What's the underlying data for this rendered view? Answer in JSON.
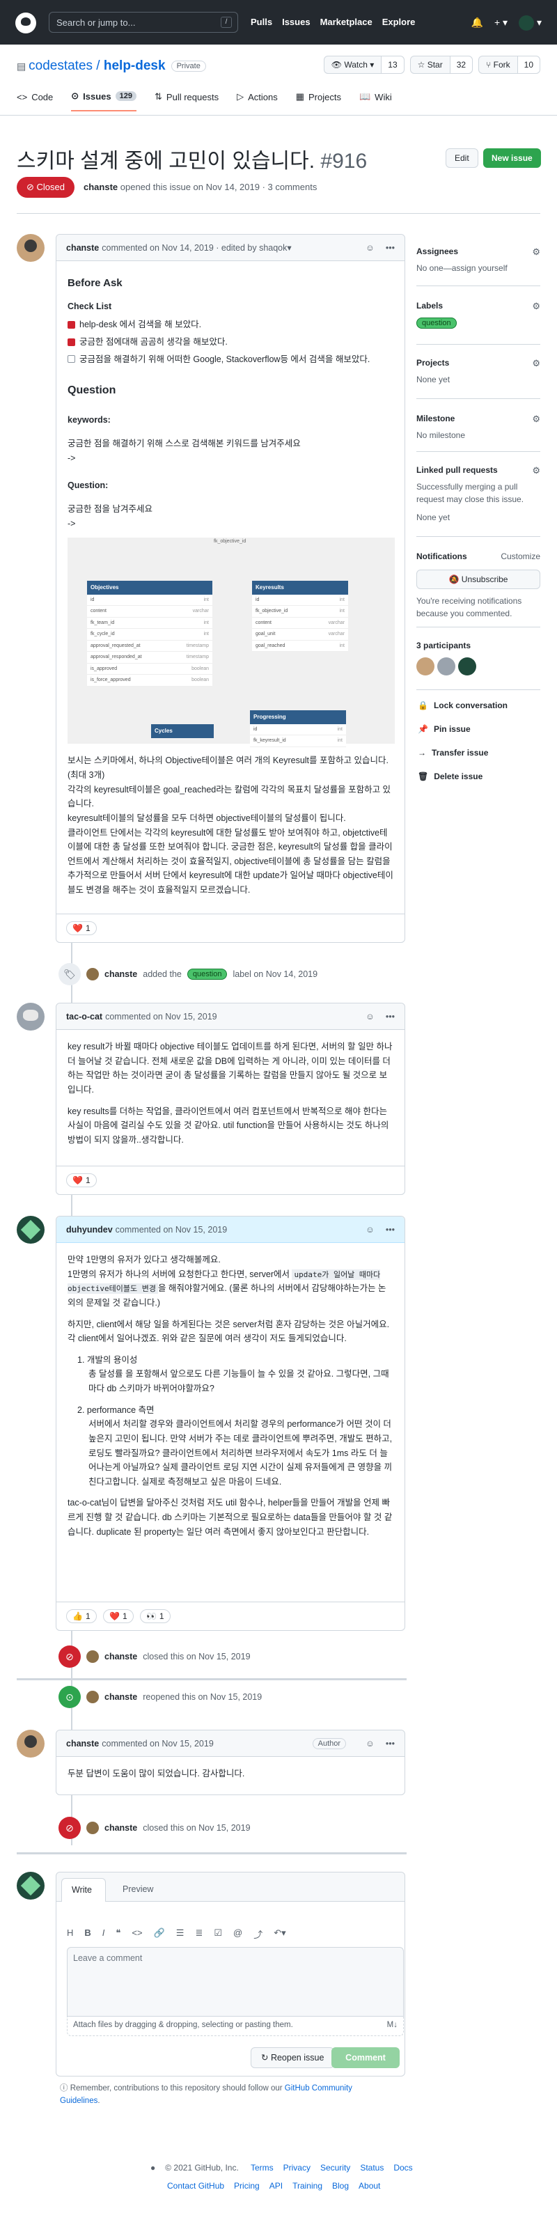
{
  "header": {
    "search_placeholder": "Search or jump to...",
    "slash": "/",
    "nav": [
      "Pulls",
      "Issues",
      "Marketplace",
      "Explore"
    ]
  },
  "repo": {
    "owner": "codestates",
    "sep": " / ",
    "name": "help-desk",
    "visibility": "Private",
    "watch": {
      "label": "Watch",
      "count": "13"
    },
    "star": {
      "label": "Star",
      "count": "32"
    },
    "fork": {
      "label": "Fork",
      "count": "10"
    }
  },
  "tabs": [
    {
      "label": "Code"
    },
    {
      "label": "Issues",
      "count": "129"
    },
    {
      "label": "Pull requests"
    },
    {
      "label": "Actions"
    },
    {
      "label": "Projects"
    },
    {
      "label": "Wiki"
    }
  ],
  "issue": {
    "title": "스키마 설계 중에 고민이 있습니다.",
    "number": "#916",
    "edit": "Edit",
    "new_issue": "New issue",
    "state": "Closed",
    "author": "chanste",
    "meta": "opened this issue on Nov 14, 2019 · 3 comments"
  },
  "c1": {
    "author": "chanste",
    "meta": "commented on Nov 14, 2019 · edited by shaqok",
    "before_ask": "Before Ask",
    "checklist": "Check List",
    "items": [
      "help-desk 에서 검색을 해 보았다.",
      "궁금한 점에대해 곰곰히 생각을 해보았다.",
      "궁금점을 해결하기 위해 어떠한 Google, Stackoverflow등 에서 검색을 해보았다."
    ],
    "question": "Question",
    "keywords": "keywords:",
    "kw_text": "궁금한 점을 해결하기 위해 스스로 검색해본 키워드를 남겨주세요",
    "arrow": "->",
    "question2": "Question:",
    "q_text": "궁금한 점을 남겨주세요",
    "diagram": {
      "top_label": "fk_objective_id",
      "objectives": {
        "title": "Objectives",
        "rows": [
          [
            "id",
            "int"
          ],
          [
            "content",
            "varchar"
          ],
          [
            "fk_team_id",
            "int"
          ],
          [
            "fk_cycle_id",
            "int"
          ],
          [
            "approval_requested_at",
            "timestamp"
          ],
          [
            "approval_responded_at",
            "timestamp"
          ],
          [
            "is_approved",
            "boolean"
          ],
          [
            "is_force_approved",
            "boolean"
          ]
        ]
      },
      "keyresults": {
        "title": "Keyresults",
        "rows": [
          [
            "id",
            "int"
          ],
          [
            "fk_objective_id",
            "int"
          ],
          [
            "content",
            "varchar"
          ],
          [
            "goal_unit",
            "varchar"
          ],
          [
            "goal_reached",
            "int"
          ]
        ]
      },
      "cycles": {
        "title": "Cycles"
      },
      "progressing": {
        "title": "Progressing",
        "rows": [
          [
            "id",
            "int"
          ],
          [
            "fk_keyresult_id",
            "int"
          ]
        ]
      }
    },
    "body": [
      "보시는 스키마에서, 하나의 Objective테이블은 여러 개의 Keyresult를 포함하고 있습니다.(최대 3개)",
      "각각의 keyresult테이블은 goal_reached라는 칼럼에 각각의 목표치 달성률을 포함하고 있습니다.",
      "keyresult테이블의 달성률을 모두 더하면 objective테이블의 달성률이 됩니다.",
      "클라이언트 단에서는 각각의 keyresult에 대한 달성률도 받아 보여줘야 하고, objetctive테이블에 대한 총 달성률 또한 보여줘야 합니다. 궁금한 점은, keyresult의 달성률 합을 클라이언트에서 계산해서 처리하는 것이 효율적일지, objective테이블에 총 달성률을 담는 칼럼을 추가적으로 만들어서 서버 단에서 keyresult에 대한 update가 일어날 때마다 objective테이블도 변경을 해주는 것이 효율적일지 모르겠습니다."
    ],
    "reaction": {
      "icon": "❤️",
      "count": "1"
    }
  },
  "ev1": {
    "author": "chanste",
    "text1": "added the",
    "label": "question",
    "text2": "label on Nov 14, 2019"
  },
  "c2": {
    "author": "tac-o-cat",
    "meta": "commented on Nov 15, 2019",
    "body": [
      "key result가 바뀔 때마다 objective 테이블도 업데이트를 하게 된다면, 서버의 할 일만 하나 더 늘어날 것 같습니다. 전체 새로운 값을 DB에 입력하는 게 아니라, 이미 있는 데이터를 더하는 작업만 하는 것이라면 굳이 총 달성률을 기록하는 칼럼을 만들지 않아도 될 것으로 보입니다.",
      "key results를 더하는 작업을, 클라이언트에서 여러 컴포넌트에서 반복적으로 해야 한다는 사실이 마음에 걸리실 수도 있을 것 같아요. util function을 만들어 사용하시는 것도 하나의 방법이 되지 않을까..생각합니다."
    ],
    "reaction": {
      "icon": "❤️",
      "count": "1"
    }
  },
  "c3": {
    "author": "duhyundev",
    "meta": "commented on Nov 15, 2019",
    "p1": "만약 1만명의 유저가 있다고 생각해볼께요.",
    "p2a": "1만명의 유저가 하나의 서버에 요청한다고 한다면, server에서 ",
    "code1": "update가 일어날 때마다 objective테이블도 변경",
    "p2b": "을 해줘야할거에요. (물론 하나의 서버에서 감당해야하는가는 논외의 문제일 것 같습니다.)",
    "p3": "하지만, client에서 해당 일을 하게된다는 것은 server처럼 혼자 감당하는 것은 아닐거에요. 각 client에서 일어나겠죠. 위와 같은 질문에 여러 생각이 저도 들게되었습니다.",
    "l1_title": "1. 개발의 용이성",
    "l1_text": "총 달성률 을 포함해서 앞으로도 다른 기능들이 늘 수 있을 것 같아요. 그렇다면, 그때마다 db 스키마가 바뀌어야할까요?",
    "l2_title": "2. performance 측면",
    "l2_text": "서버에서 처리할 경우와 클라이언트에서 처리할 경우의 performance가 어떤 것이 더 높은지 고민이 됩니다. 만약 서버가 주는 데로 클라이언트에 뿌려주면, 개발도 편하고, 로딩도 빨라질까요? 클라이언트에서 처리하면 브라우저에서 속도가 1ms 라도 더 늘어나는게 아닐까요? 실제 클라이언트 로딩 지연 시간이 실제 유저들에게 큰 영향을 끼친다고합니다. 실제로 측정해보고 싶은 마음이 드네요.",
    "p4": "tac-o-cat님이 답변을 달아주신 것처럼 저도 util 함수나, helper들을 만들어 개발을 언제 빠르게 진행 할 것 같습니다. db 스키마는 기본적으로 필요로하는 data들을 만들어야 할 것 같습니다. duplicate 된 property는 일단 여러 측면에서 좋지 않아보인다고 판단합니다.",
    "reactions": [
      {
        "icon": "👍",
        "count": "1"
      },
      {
        "icon": "❤️",
        "count": "1"
      },
      {
        "icon": "👀",
        "count": "1"
      }
    ]
  },
  "ev2": {
    "author": "chanste",
    "text": "closed this on Nov 15, 2019"
  },
  "ev3": {
    "author": "chanste",
    "text": "reopened this on Nov 15, 2019"
  },
  "c4": {
    "author": "chanste",
    "meta": "commented on Nov 15, 2019",
    "badge": "Author",
    "body": "두분 답변이 도움이 많이 되었습니다. 감사합니다."
  },
  "ev4": {
    "author": "chanste",
    "text": "closed this on Nov 15, 2019"
  },
  "composer": {
    "write": "Write",
    "preview": "Preview",
    "placeholder": "Leave a comment",
    "attach": "Attach files by dragging & dropping, selecting or pasting them.",
    "reopen": "Reopen issue",
    "comment": "Comment",
    "note_a": "Remember, contributions to this repository should follow our ",
    "note_link": "GitHub Community Guidelines",
    "note_b": "."
  },
  "sidebar": {
    "assignees": "Assignees",
    "assignees_v": "No one—assign yourself",
    "labels": "Labels",
    "label_v": "question",
    "projects": "Projects",
    "projects_v": "None yet",
    "milestone": "Milestone",
    "milestone_v": "No milestone",
    "linked": "Linked pull requests",
    "linked_desc": "Successfully merging a pull request may close this issue.",
    "linked_v": "None yet",
    "notifications": "Notifications",
    "customize": "Customize",
    "unsubscribe": "Unsubscribe",
    "notif_desc": "You're receiving notifications because you commented.",
    "participants": "3 participants",
    "lock": "Lock conversation",
    "pin": "Pin issue",
    "transfer": "Transfer issue",
    "delete": "Delete issue"
  },
  "footer": {
    "copyright": "© 2021 GitHub, Inc.",
    "row1": [
      "Terms",
      "Privacy",
      "Security",
      "Status",
      "Docs"
    ],
    "row2": [
      "Contact GitHub",
      "Pricing",
      "API",
      "Training",
      "Blog",
      "About"
    ]
  },
  "colors": {
    "closed": "#cf222e",
    "open": "#2da44e",
    "link": "#0969da"
  }
}
